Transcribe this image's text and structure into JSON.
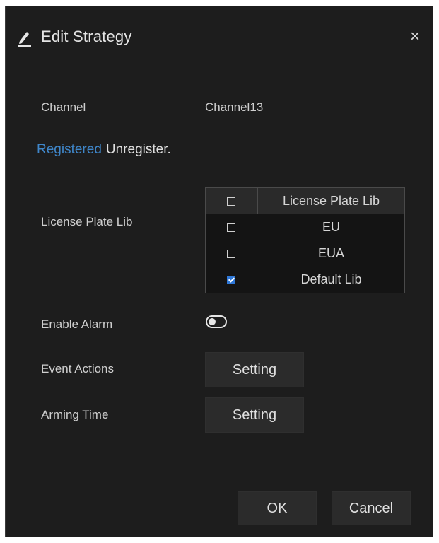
{
  "dialog": {
    "title": "Edit Strategy",
    "close_glyph": "×",
    "icons": {
      "edit": "pencil-icon",
      "close": "close-icon"
    }
  },
  "channel": {
    "label": "Channel",
    "value": "Channel13"
  },
  "tabs": [
    {
      "label": "Registered",
      "active": true
    },
    {
      "label": "Unregister.",
      "active": false
    }
  ],
  "license_plate_lib": {
    "label": "License Plate Lib",
    "header": "License Plate Lib",
    "rows": [
      {
        "name": "EU",
        "checked": false
      },
      {
        "name": "EUA",
        "checked": false
      },
      {
        "name": "Default Lib",
        "checked": true
      }
    ]
  },
  "enable_alarm": {
    "label": "Enable Alarm",
    "enabled": false
  },
  "event_actions": {
    "label": "Event Actions",
    "button": "Setting"
  },
  "arming_time": {
    "label": "Arming Time",
    "button": "Setting"
  },
  "footer": {
    "ok": "OK",
    "cancel": "Cancel"
  },
  "colors": {
    "background": "#1d1d1d",
    "accent": "#3f86c9",
    "checkbox_checked": "#2f78d8"
  }
}
